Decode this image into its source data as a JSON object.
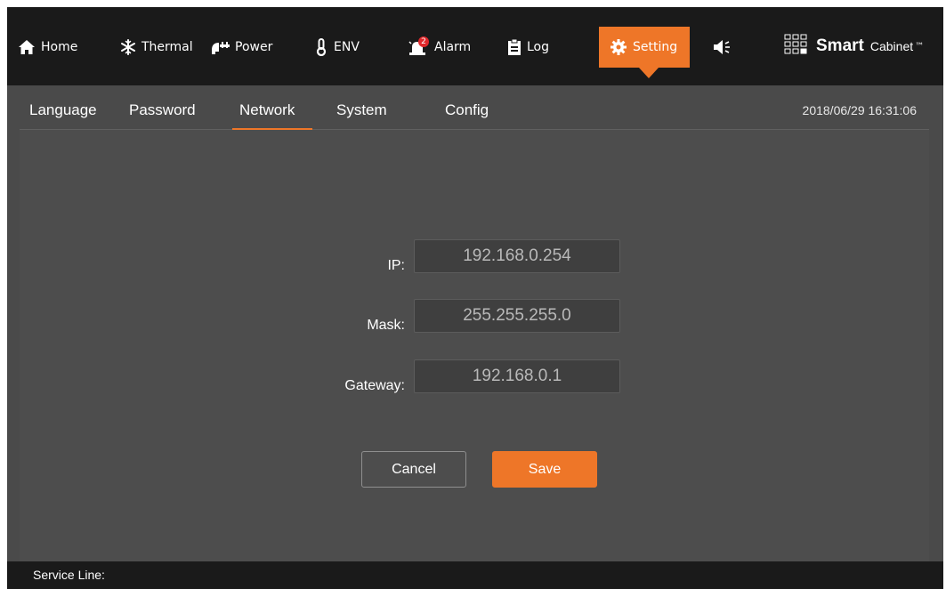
{
  "nav": {
    "items": [
      {
        "label": "Home",
        "icon": "home-icon"
      },
      {
        "label": "Thermal",
        "icon": "snowflake-icon"
      },
      {
        "label": "Power",
        "icon": "plug-icon"
      },
      {
        "label": "ENV",
        "icon": "thermometer-icon"
      },
      {
        "label": "Alarm",
        "icon": "alarm-siren-icon",
        "badge": "2"
      },
      {
        "label": "Log",
        "icon": "clipboard-icon"
      },
      {
        "label": "Setting",
        "icon": "gear-icon",
        "active": true
      }
    ],
    "sound_icon": "speaker-icon"
  },
  "brand": {
    "bold": "Smart",
    "rest": "Cabinet",
    "tm": "™"
  },
  "subnav": {
    "tabs": [
      "Language",
      "Password",
      "Network",
      "System",
      "Config"
    ],
    "active_tab": "Network",
    "datetime": "2018/06/29 16:31:06"
  },
  "form": {
    "ip": {
      "label": "IP:",
      "value": "192.168.0.254"
    },
    "mask": {
      "label": "Mask:",
      "value": "255.255.255.0"
    },
    "gateway": {
      "label": "Gateway:",
      "value": "192.168.0.1"
    },
    "cancel_label": "Cancel",
    "save_label": "Save"
  },
  "footer": {
    "service_line": "Service Line:"
  },
  "colors": {
    "accent": "#ee7628",
    "topbar_bg": "#1a1a1a",
    "panel_bg": "#4a4a4a",
    "input_bg": "#3f3f3f",
    "badge": "#e0282b"
  }
}
